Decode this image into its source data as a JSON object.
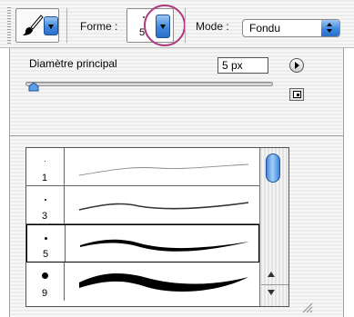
{
  "toolbar": {
    "tool_icon": "brush-icon",
    "shape_label": "Forme :",
    "shape_value": "5",
    "mode_label": "Mode :",
    "mode_value": "Fondu",
    "accent_color": "#3f88de",
    "highlight_color": "#b03a7e"
  },
  "panel": {
    "diameter_label": "Diamètre principal",
    "diameter_value": "5 px",
    "menu_icon": "play-circle-icon",
    "new_preset_icon": "new-preset-icon"
  },
  "brushes": [
    {
      "size": "1"
    },
    {
      "size": "3"
    },
    {
      "size": "5",
      "selected": true
    },
    {
      "size": "9"
    }
  ]
}
